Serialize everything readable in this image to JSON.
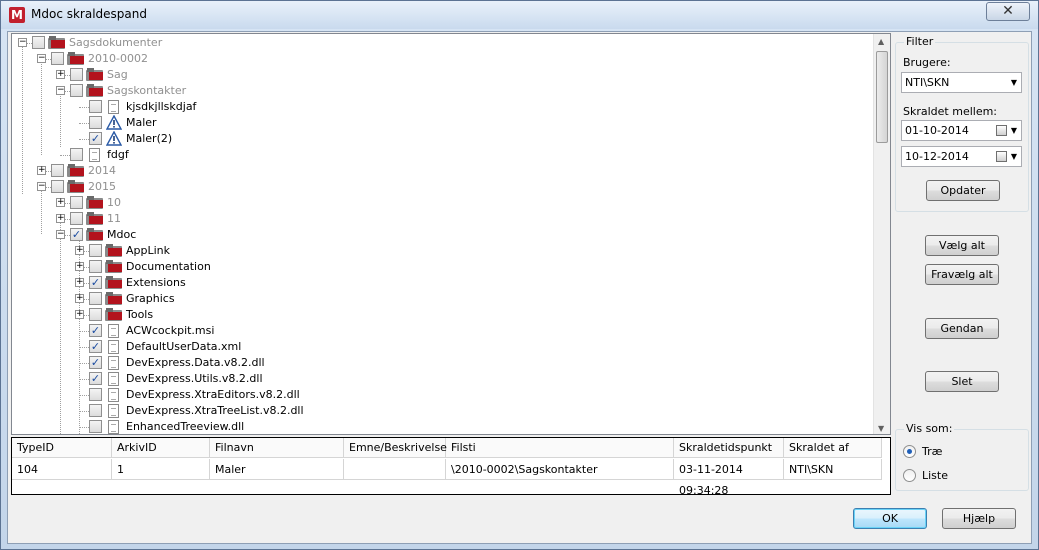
{
  "window": {
    "title": "Mdoc skraldespand",
    "app_icon": "M",
    "close_symbol": "✕"
  },
  "tree": {
    "nodes": [
      {
        "label": "Sagsdokumenter",
        "checked": false,
        "greyed": true
      },
      {
        "label": "2010-0002",
        "checked": false,
        "greyed": true
      },
      {
        "label": "Sag",
        "checked": false,
        "greyed": true
      },
      {
        "label": "Sagskontakter",
        "checked": false,
        "greyed": true
      },
      {
        "label": "kjsdkjllskdjaf",
        "checked": false,
        "greyed": false
      },
      {
        "label": "Maler",
        "checked": false,
        "greyed": false
      },
      {
        "label": "Maler(2)",
        "checked": true,
        "greyed": false
      },
      {
        "label": "fdgf",
        "checked": false,
        "greyed": false
      },
      {
        "label": "2014",
        "checked": false,
        "greyed": true
      },
      {
        "label": "2015",
        "checked": false,
        "greyed": true
      },
      {
        "label": "10",
        "checked": false,
        "greyed": true
      },
      {
        "label": "11",
        "checked": false,
        "greyed": true
      },
      {
        "label": "Mdoc",
        "checked": true,
        "greyed": false
      },
      {
        "label": "AppLink",
        "checked": false,
        "greyed": false
      },
      {
        "label": "Documentation",
        "checked": false,
        "greyed": false
      },
      {
        "label": "Extensions",
        "checked": true,
        "greyed": false
      },
      {
        "label": "Graphics",
        "checked": false,
        "greyed": false
      },
      {
        "label": "Tools",
        "checked": false,
        "greyed": false
      },
      {
        "label": "ACWcockpit.msi",
        "checked": true,
        "greyed": false
      },
      {
        "label": "DefaultUserData.xml",
        "checked": true,
        "greyed": false
      },
      {
        "label": "DevExpress.Data.v8.2.dll",
        "checked": true,
        "greyed": false
      },
      {
        "label": "DevExpress.Utils.v8.2.dll",
        "checked": true,
        "greyed": false
      },
      {
        "label": "DevExpress.XtraEditors.v8.2.dll",
        "checked": false,
        "greyed": false
      },
      {
        "label": "DevExpress.XtraTreeList.v8.2.dll",
        "checked": false,
        "greyed": false
      },
      {
        "label": "EnhancedTreeview.dll",
        "checked": false,
        "greyed": false
      }
    ]
  },
  "grid": {
    "columns": [
      "TypeID",
      "ArkivID",
      "Filnavn",
      "Emne/Beskrivelse",
      "Filsti",
      "Skraldetidspunkt",
      "Skraldet af"
    ],
    "rows": [
      [
        "104",
        "1",
        "Maler",
        "",
        "\\2010-0002\\Sagskontakter",
        "03-11-2014 09:34:28",
        "NTI\\SKN"
      ]
    ]
  },
  "filter": {
    "title": "Filter",
    "users_label": "Brugere:",
    "users_value": "NTI\\SKN",
    "between_label": "Skraldet mellem:",
    "date_from": "01-10-2014",
    "date_to": "10-12-2014",
    "update_label": "Opdater"
  },
  "actions": {
    "select_all": "Vælg alt",
    "deselect_all": "Fravælg alt",
    "restore": "Gendan",
    "delete": "Slet"
  },
  "view_as": {
    "title": "Vis som:",
    "options": [
      {
        "label": "Træ",
        "selected": true
      },
      {
        "label": "Liste",
        "selected": false
      }
    ]
  },
  "footer": {
    "ok": "OK",
    "help": "Hjælp"
  },
  "colors": {
    "folder_flag": "#b3131d",
    "selected_radio": "#1f5fb8",
    "check": "#1a4ba0",
    "default_button": "#3c7fb1"
  }
}
